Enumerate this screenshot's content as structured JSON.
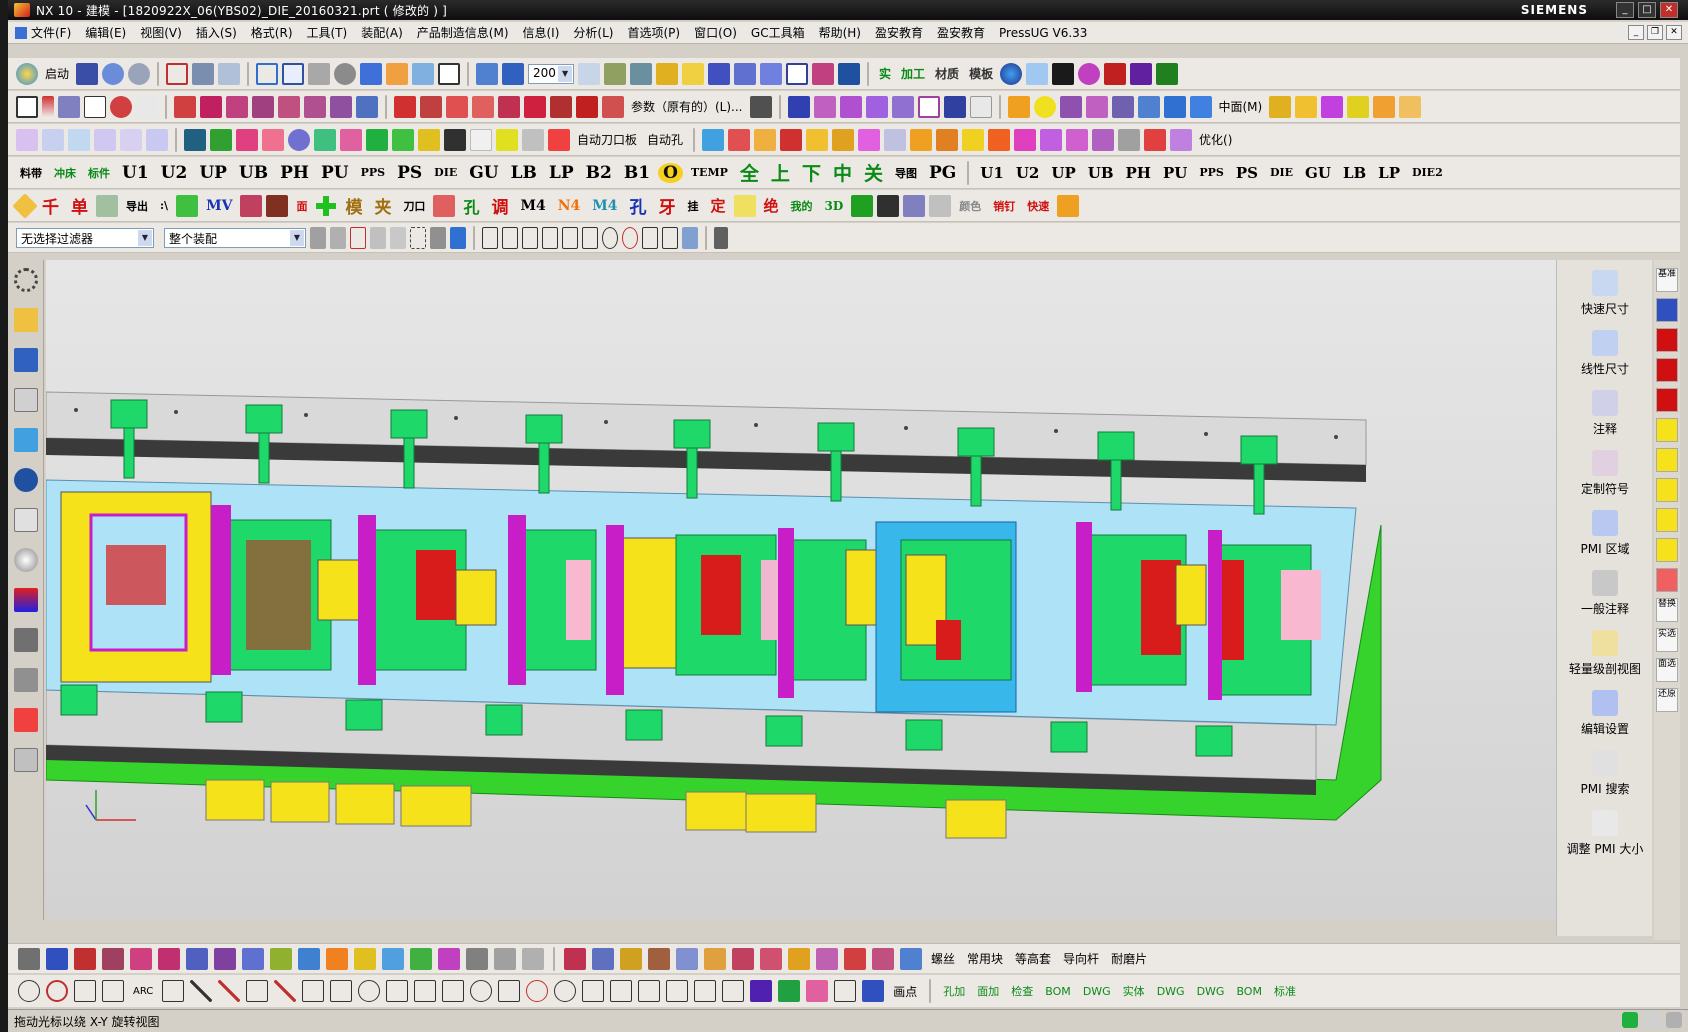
{
  "window": {
    "title": "NX 10 - 建模 - [1820922X_06(YBS02)_DIE_20160321.prt  ( 修改的 ) ]",
    "brand": "SIEMENS"
  },
  "menu": [
    "文件(F)",
    "编辑(E)",
    "视图(V)",
    "插入(S)",
    "格式(R)",
    "工具(T)",
    "装配(A)",
    "产品制造信息(M)",
    "信息(I)",
    "分析(L)",
    "首选项(P)",
    "窗口(O)",
    "GC工具箱",
    "帮助(H)",
    "盈安教育",
    "盈安教育",
    "PressUG V6.33"
  ],
  "toolbar1": {
    "start_label": "启动",
    "zoom_value": "200",
    "pan_labels": [
      "实",
      "加工",
      "材质",
      "模板"
    ]
  },
  "toolbar2": {
    "param_label": "参数（原有的）(L)...",
    "middle_label": "中面(M)"
  },
  "toolbar3": {
    "auto_knife": "自动刀口板",
    "auto_hole": "自动孔",
    "optimize": "优化()"
  },
  "toolbar4": {
    "chips": [
      "料带",
      "冲床",
      "标件",
      "U1",
      "U2",
      "UP",
      "UB",
      "PH",
      "PU",
      "PPS",
      "PS",
      "DIE",
      "GU",
      "LB",
      "LP",
      "B2",
      "B1",
      "O",
      "TEMP",
      "全",
      "上",
      "下",
      "中",
      "关",
      "导图",
      "PG",
      "U1",
      "U2",
      "UP",
      "UB",
      "PH",
      "PU",
      "PPS",
      "PS",
      "DIE",
      "GU",
      "LB",
      "LP",
      "DIE2"
    ]
  },
  "toolbar5": {
    "chips": [
      "千",
      "单",
      "导出",
      ":\\",
      "MV",
      "面",
      "模",
      "夹",
      "刀口",
      "孔",
      "调",
      "M4",
      "N4",
      "M4",
      "孔",
      "牙",
      "挂",
      "定",
      "绝",
      "我的",
      "3D",
      "颜色",
      "销钉",
      "快速"
    ]
  },
  "filterbar": {
    "selection_filter": "无选择过滤器",
    "scope": "整个装配"
  },
  "pmi_panel": {
    "items": [
      "快速尺寸",
      "线性尺寸",
      "注释",
      "定制符号",
      "PMI 区域",
      "一般注释",
      "轻量级剖视图",
      "编辑设置",
      "PMI 搜索",
      "调整 PMI 大小"
    ]
  },
  "right_strip": [
    "基准",
    "替换",
    "实选",
    "面选",
    "还原"
  ],
  "bottom_toolbar1": {
    "labels": [
      "螺丝",
      "常用块",
      "等高套",
      "导向杆",
      "耐磨片"
    ]
  },
  "bottom_toolbar2": {
    "labels": [
      "ARC",
      "画点",
      "孔加",
      "面加",
      "检查",
      "BOM",
      "DWG",
      "实体",
      "DWG",
      "DWG",
      "BOM",
      "标准"
    ]
  },
  "status": {
    "message": "拖动光标以绕 X-Y 旋转视图"
  },
  "colors": {
    "plate_blue": "#aee2f6",
    "part_green": "#1ed86a",
    "part_magenta": "#c81ec8",
    "part_yellow": "#f5e21a",
    "part_red": "#d81c1c",
    "frame_gray": "#d7d7d7",
    "base_green": "#36d32c"
  }
}
